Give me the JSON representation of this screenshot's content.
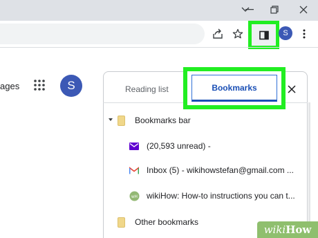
{
  "window": {
    "controls": [
      "chevron-down-icon",
      "minimize-icon",
      "restore-icon",
      "close-icon"
    ]
  },
  "toolbar": {
    "profile_initial": "S",
    "icons": [
      "share-icon",
      "star-icon",
      "side-panel-icon",
      "more-menu-icon"
    ]
  },
  "page": {
    "partial_text": "ages",
    "profile_initial": "S"
  },
  "side_panel": {
    "tabs": [
      {
        "label": "Reading list",
        "selected": false
      },
      {
        "label": "Bookmarks",
        "selected": true
      }
    ],
    "bookmarks": [
      {
        "label": "Bookmarks bar",
        "type": "folder",
        "expanded": true
      },
      {
        "label": "(20,593 unread) -",
        "icon": "yahoo-mail-icon"
      },
      {
        "label": "Inbox (5) - wikihowstefan@gmail.com ...",
        "icon": "gmail-icon"
      },
      {
        "label": "wikiHow: How-to instructions you can t...",
        "icon": "wikihow-icon"
      },
      {
        "label": "Other bookmarks",
        "type": "folder"
      }
    ]
  },
  "watermark": {
    "part1": "wiki",
    "part2": "How"
  },
  "colors": {
    "highlight": "#22ee22",
    "accent": "#1a4fb5",
    "avatar": "#3c59b5"
  }
}
